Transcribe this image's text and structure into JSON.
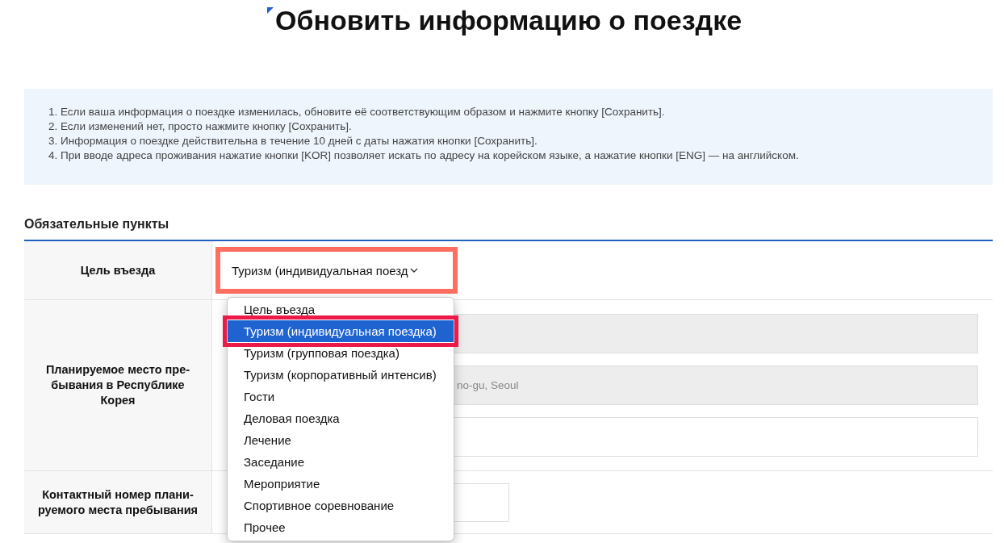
{
  "title": "Обновить информацию о поездке",
  "notices": [
    "1. Если ваша информация о поездке изменилась, обновите её соответствующим образом и нажмите кнопку [Сохранить].",
    "2. Если изменений нет, просто нажмите кнопку [Сохранить].",
    "3. Информация о поездке действительна в течение 10 дней с даты нажатия кнопки [Сохранить].",
    "4. При вводе адреса проживания нажатие кнопки [KOR] позволяет искать по адресу на корейском языке, а нажатие кнопки [ENG] — на английском."
  ],
  "section_title": "Обязательные пункты",
  "rows": [
    {
      "label": "Цель въезда",
      "kind": "select",
      "value": "Туризм (индивидуальная поезд"
    },
    {
      "label": "Планируемое место пре-бывания в Республике Корея",
      "kind": "address",
      "fields": [
        {
          "disabled": true
        },
        {
          "value": "no-gu, Seoul",
          "disabled": true
        },
        {
          "disabled": false
        }
      ]
    },
    {
      "label": "Контактный номер плани-руемого места пребывания",
      "kind": "phone"
    }
  ],
  "dropdown": {
    "options": [
      {
        "label": "Цель въезда",
        "selected": false
      },
      {
        "label": "Туризм (индивидуальная поездка)",
        "selected": true
      },
      {
        "label": "Туризм (групповая поездка)",
        "selected": false
      },
      {
        "label": "Туризм (корпоративный интенсив)",
        "selected": false
      },
      {
        "label": "Гости",
        "selected": false
      },
      {
        "label": "Деловая поездка",
        "selected": false
      },
      {
        "label": "Лечение",
        "selected": false
      },
      {
        "label": "Заседание",
        "selected": false
      },
      {
        "label": "Мероприятие",
        "selected": false
      },
      {
        "label": "Спортивное соревнование",
        "selected": false
      },
      {
        "label": "Прочее",
        "selected": false
      }
    ]
  }
}
